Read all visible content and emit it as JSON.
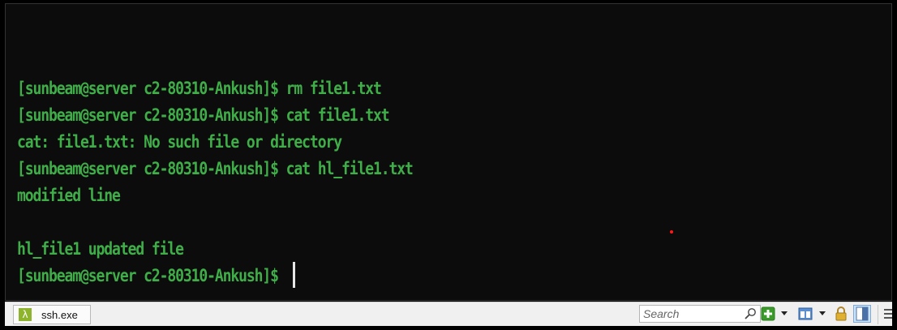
{
  "terminal": {
    "lines": [
      "[sunbeam@server c2-80310-Ankush]$ rm file1.txt",
      "[sunbeam@server c2-80310-Ankush]$ cat file1.txt",
      "cat: file1.txt: No such file or directory",
      "[sunbeam@server c2-80310-Ankush]$ cat hl_file1.txt",
      "modified line",
      "",
      "hl_file1 updated file",
      "[sunbeam@server c2-80310-Ankush]$ "
    ],
    "text_color": "#3fae49",
    "background": "#0c0c0c"
  },
  "statusbar": {
    "tab_label": "ssh.exe",
    "tab_icon_glyph": "λ",
    "search_placeholder": "Search"
  },
  "icons": {
    "tab_icon": "lambda-icon",
    "search": "search-icon",
    "new_console": "add-console-icon",
    "layout": "layout-icon",
    "lock": "lock-icon",
    "panel": "panel-icon",
    "menu": "menu-icon"
  }
}
